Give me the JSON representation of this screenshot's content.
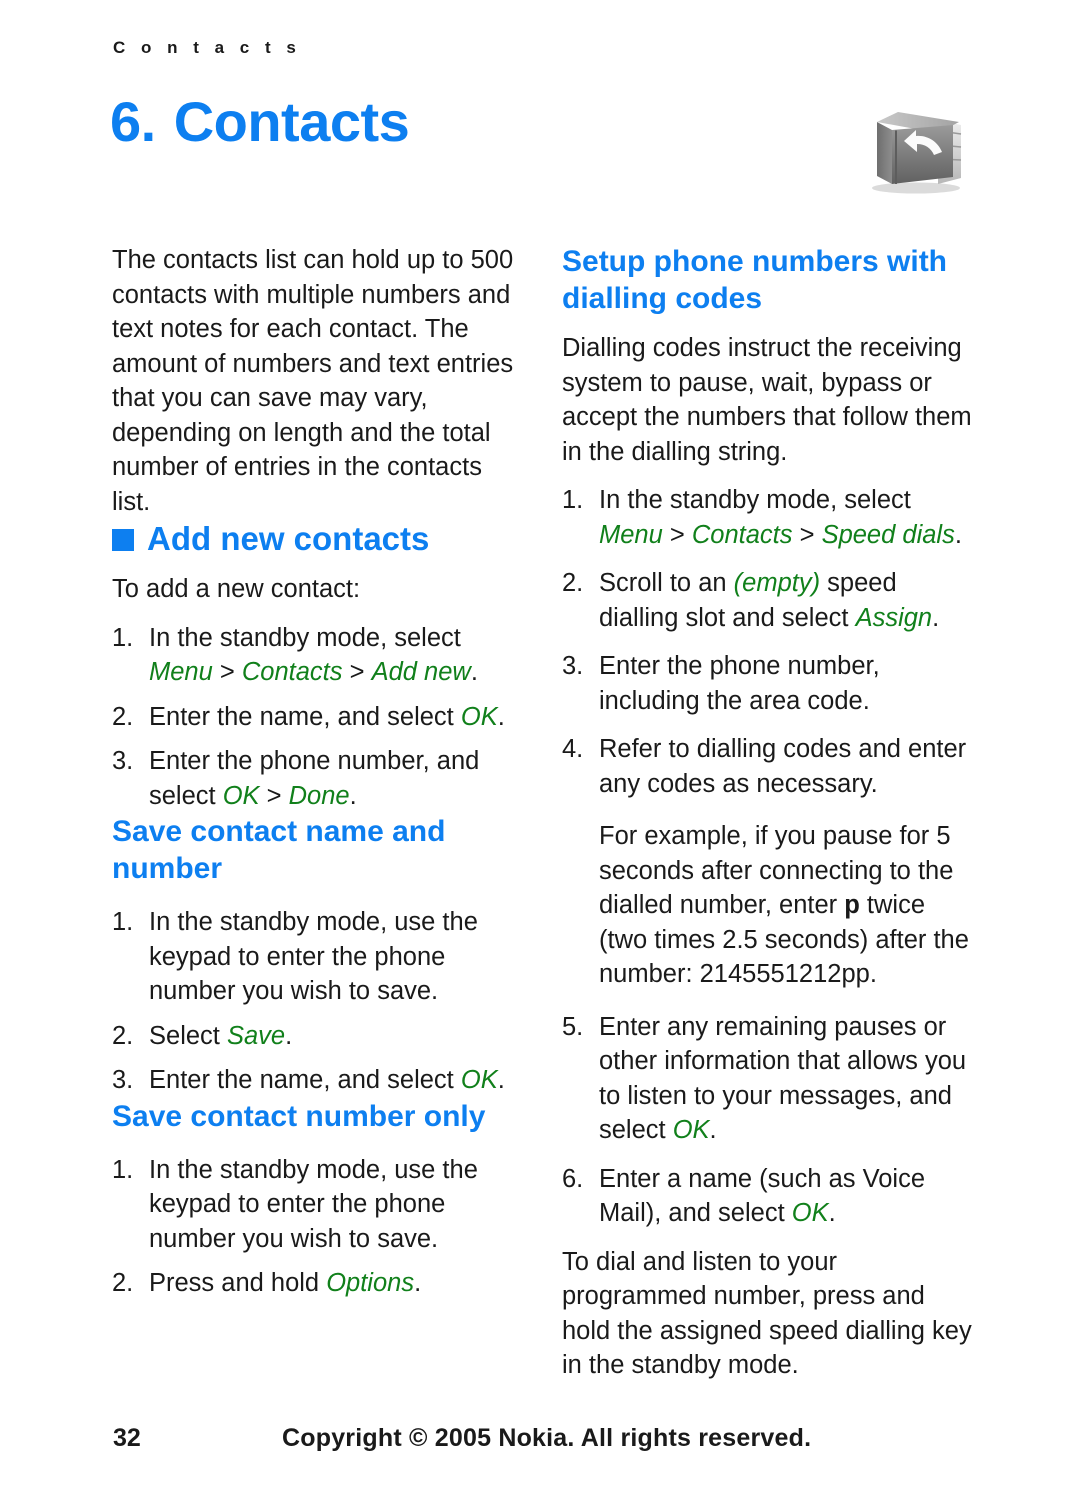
{
  "running_head": "C o n t a c t s",
  "chapter": {
    "number": "6.",
    "title": "Contacts",
    "icon": "contacts-book-icon"
  },
  "left_column": {
    "intro": "The contacts list can hold up to 500 contacts with multiple numbers and text notes for each contact. The amount of numbers and text entries that you can save may vary, depending on length and the total number of entries in the contacts list.",
    "section_heading": "Add new contacts",
    "section_lead": "To add a new contact:",
    "steps": [
      {
        "marker": "1.",
        "text_before": "In the standby mode, select ",
        "menu_path": [
          "Menu",
          "Contacts",
          "Add new"
        ],
        "text_after": "."
      },
      {
        "marker": "2.",
        "text_before": "Enter the name, and select ",
        "term": "OK",
        "text_after": "."
      },
      {
        "marker": "3.",
        "text_before": "Enter the phone number, and select ",
        "menu_path": [
          "OK",
          "Done"
        ],
        "text_after": "."
      }
    ],
    "sub_heading_1": "Save contact name and number",
    "steps_name_number": [
      {
        "marker": "1.",
        "text": "In the standby mode, use the keypad to enter the phone number you wish to save."
      },
      {
        "marker": "2.",
        "text_before": "Select ",
        "term": "Save",
        "text_after": "."
      },
      {
        "marker": "3.",
        "text_before": "Enter the name, and select ",
        "term": "OK",
        "text_after": "."
      }
    ],
    "sub_heading_2": "Save contact number only",
    "steps_number_only": [
      {
        "marker": "1.",
        "text": "In the standby mode, use the keypad to enter the phone number you wish to save."
      },
      {
        "marker": "2.",
        "text_before": "Press and hold ",
        "term": "Options",
        "text_after": "."
      }
    ]
  },
  "right_column": {
    "sub_heading": "Setup phone numbers with dialling codes",
    "intro": "Dialling codes instruct the receiving system to pause, wait, bypass or accept the numbers that follow them in the dialling string.",
    "steps": [
      {
        "marker": "1.",
        "text_before": "In the standby mode, select ",
        "menu_path": [
          "Menu",
          "Contacts",
          "Speed dials"
        ],
        "text_after": "."
      },
      {
        "marker": "2.",
        "part_a": "Scroll to an ",
        "term_a": "(empty)",
        "part_b": " speed dialling slot and select ",
        "term_b": "Assign",
        "part_c": "."
      },
      {
        "marker": "3.",
        "text": "Enter the phone number, including the area code."
      },
      {
        "marker": "4.",
        "text": "Refer to dialling codes and enter any codes as necessary."
      }
    ],
    "example_a": "For example, if you pause for 5 seconds after connecting to the dialled number, enter ",
    "example_bold": "p",
    "example_b": " twice (two times 2.5 seconds) after the number: 2145551212pp.",
    "steps_tail": [
      {
        "marker": "5.",
        "text_before": "Enter any remaining pauses or other information that allows you to listen to your messages, and select ",
        "term": "OK",
        "text_after": "."
      },
      {
        "marker": "6.",
        "text_before": "Enter a name (such as Voice Mail), and select ",
        "term": "OK",
        "text_after": "."
      }
    ],
    "closing": "To dial and listen to your programmed number, press and hold the assigned speed dialling key in the standby mode."
  },
  "footer": {
    "page_number": "32",
    "copyright": "Copyright © 2005 Nokia. All rights reserved."
  },
  "colors": {
    "heading_blue": "#0d7ff0",
    "menu_green": "#11801b",
    "body_black": "#1a1a1a"
  }
}
